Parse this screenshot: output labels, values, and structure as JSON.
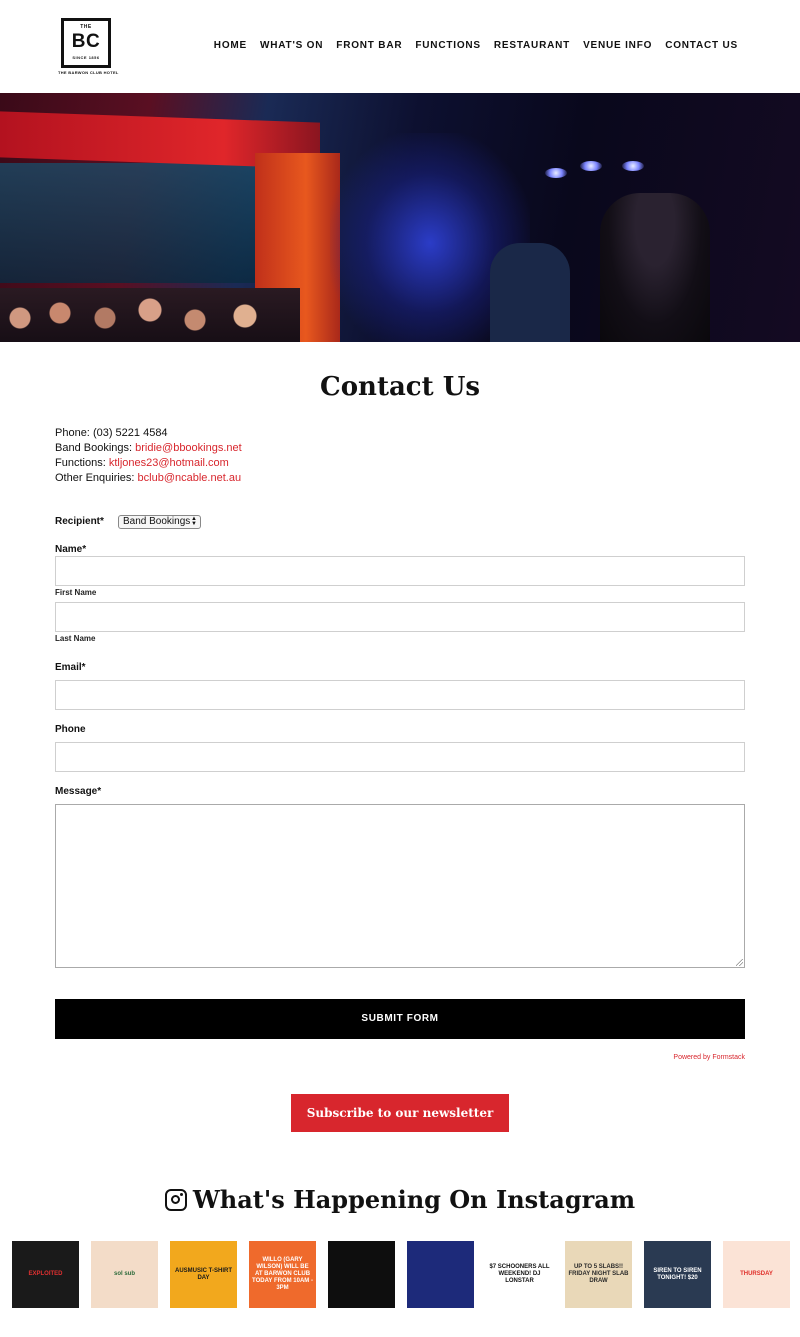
{
  "logo": {
    "top": "THE",
    "main": "BC",
    "since": "SINCE 1856",
    "sub": "THE BARWON CLUB HOTEL"
  },
  "nav": [
    "HOME",
    "WHAT'S ON",
    "FRONT BAR",
    "FUNCTIONS",
    "RESTAURANT",
    "VENUE INFO",
    "CONTACT US"
  ],
  "contact": {
    "title": "Contact Us",
    "phone_label": "Phone:",
    "phone": "(03) 5221 4584",
    "band_label": "Band Bookings:",
    "band_email": "bridie@bbookings.net",
    "functions_label": "Functions:",
    "functions_email": "ktljones23@hotmail.com",
    "other_label": "Other Enquiries:",
    "other_email": "bclub@ncable.net.au"
  },
  "form": {
    "recipient_label": "Recipient*",
    "recipient_value": "Band Bookings",
    "name_label": "Name*",
    "first_name_label": "First Name",
    "last_name_label": "Last Name",
    "email_label": "Email*",
    "phone_label": "Phone",
    "message_label": "Message*",
    "submit_label": "SUBMIT FORM",
    "powered_by": "Powered by Formstack"
  },
  "newsletter_label": "Subscribe to our newsletter",
  "instagram": {
    "title": "What's Happening On Instagram",
    "posts": [
      {
        "text": "EXPLOITED",
        "bg": "#1a1a1a",
        "fg": "#e03030"
      },
      {
        "text": "sol sub",
        "bg": "#f3dcc8",
        "fg": "#2b6a3a"
      },
      {
        "text": "AUSMUSIC T-SHIRT DAY",
        "bg": "#f2a81d",
        "fg": "#1a1a1a"
      },
      {
        "text": "WILLO (GARY WILSON) WILL BE AT BARWON CLUB TODAY FROM 10AM - 3PM",
        "bg": "#ef6a2c",
        "fg": "#ffffff"
      },
      {
        "text": "",
        "bg": "#0e0e0e",
        "fg": "#cccccc"
      },
      {
        "text": "",
        "bg": "#1d2a7a",
        "fg": "#f0d040"
      },
      {
        "text": "$7 SCHOONERS ALL WEEKEND! DJ LONSTAR",
        "bg": "#ffffff",
        "fg": "#111111"
      },
      {
        "text": "UP TO 5 SLABS!! FRIDAY NIGHT SLAB DRAW",
        "bg": "#e9d8b8",
        "fg": "#2a2a2a"
      },
      {
        "text": "SIREN TO SIREN TONIGHT! $20",
        "bg": "#2a3a52",
        "fg": "#ffffff"
      },
      {
        "text": "THURSDAY",
        "bg": "#fbe3d6",
        "fg": "#e0302a"
      }
    ]
  }
}
